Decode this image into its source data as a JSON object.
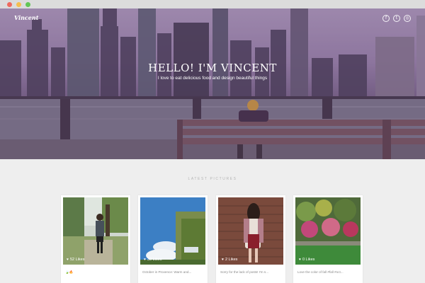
{
  "window": {
    "title_controls": [
      "close",
      "minimize",
      "maximize"
    ]
  },
  "header": {
    "brand": "Vincent",
    "socials": [
      {
        "icon": "facebook-icon",
        "glyph": "f"
      },
      {
        "icon": "twitter-icon",
        "glyph": "t"
      },
      {
        "icon": "instagram-icon",
        "glyph": "◎"
      }
    ]
  },
  "hero": {
    "title": "HELLO! I'M VINCENT",
    "subtitle": "I love to eat delicious food and design beautiful things"
  },
  "latest": {
    "heading": "LATEST PICTURES",
    "cards": [
      {
        "likes": "52 Likes",
        "caption": "🍃🔥"
      },
      {
        "likes": "30 Likes",
        "caption": "October in Provence: Warm and..."
      },
      {
        "likes": "2 Likes",
        "caption": "Sorry for the lack of posts! I'm s..."
      },
      {
        "likes": "0 Likes",
        "caption": "Love the color of fall #fall #oct..."
      }
    ]
  },
  "colors": {
    "overlay": "#5c3a6e",
    "background": "#eeeeee",
    "heading": "#b4b4b4"
  }
}
